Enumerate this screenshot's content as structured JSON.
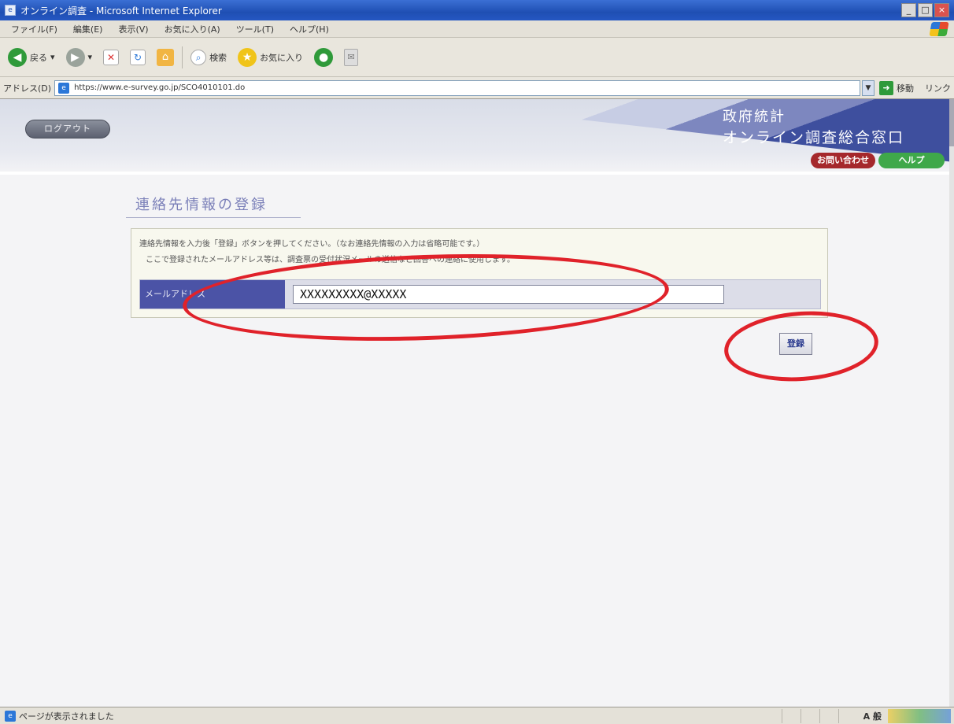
{
  "window": {
    "title": "オンライン調査 - Microsoft Internet Explorer",
    "minimize": "_",
    "maximize": "□",
    "close": "×"
  },
  "menu": {
    "items": [
      "ファイル(F)",
      "編集(E)",
      "表示(V)",
      "お気に入り(A)",
      "ツール(T)",
      "ヘルプ(H)"
    ]
  },
  "toolbar": {
    "back_label": "戻る",
    "search_label": "検索",
    "favorites_label": "お気に入り"
  },
  "address": {
    "label": "アドレス(D)",
    "url": "https://www.e-survey.go.jp/SCO4010101.do",
    "go_label": "移動",
    "links_label": "リンク"
  },
  "header": {
    "logout_label": "ログアウト",
    "site_title_line1": "政府統計",
    "site_title_line2": "オンライン調査総合窓口",
    "contact_label": "お問い合わせ",
    "help_label": "ヘルプ"
  },
  "form": {
    "section_title": "連絡先情報の登録",
    "note_line1": "連絡先情報を入力後「登録」ボタンを押してください。（なお連絡先情報の入力は省略可能です。）",
    "note_line2": "ここで登録されたメールアドレス等は、調査票の受付状況メールの送信など回答への連絡に使用します。",
    "email_label": "メールアドレス",
    "email_value": "XXXXXXXXX@XXXXX",
    "register_label": "登録"
  },
  "status": {
    "text": "ページが表示されました",
    "ime_label": "A 般"
  },
  "colors": {
    "highlight": "#e0222a",
    "field_label_bg": "#4b53a6",
    "contact": "#a5282c",
    "help": "#3fa84a"
  }
}
